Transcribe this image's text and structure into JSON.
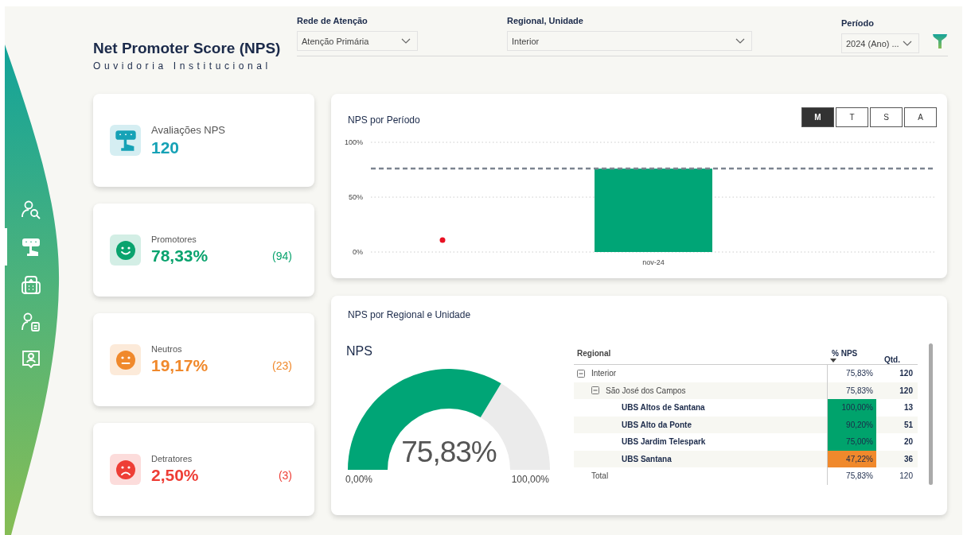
{
  "sidebar": {
    "items": [
      {
        "selected": false
      },
      {
        "selected": true
      },
      {
        "selected": false
      },
      {
        "selected": false
      },
      {
        "selected": false
      }
    ]
  },
  "header": {
    "title": "Net Promoter Score (NPS)",
    "subtitle": "Ouvidoria Institucional"
  },
  "filters": [
    {
      "label": "Rede de Atenção",
      "value": "Atenção Primária"
    },
    {
      "label": "Regional, Unidade",
      "value": "Interior"
    },
    {
      "label": "Período",
      "value": "2024 (Ano) ..."
    }
  ],
  "kpis": [
    {
      "kind": "rating",
      "label": "Avaliações NPS",
      "value": "120",
      "color": "#16a2b6"
    },
    {
      "kind": "happy",
      "label": "Promotores",
      "value": "78,33%",
      "count": "(94)",
      "color": "#0aa36e"
    },
    {
      "kind": "neutral",
      "label": "Neutros",
      "value": "19,17%",
      "count": "(23)",
      "color": "#f0892c"
    },
    {
      "kind": "sad",
      "label": "Detratores",
      "value": "2,50%",
      "count": "(3)",
      "color": "#ee3e36"
    }
  ],
  "period_chart": {
    "title": "NPS por Período",
    "periods": [
      {
        "label": "M",
        "selected": true
      },
      {
        "label": "T",
        "selected": false
      },
      {
        "label": "S",
        "selected": false
      },
      {
        "label": "A",
        "selected": false
      }
    ],
    "chart_data": {
      "type": "bar",
      "categories": [
        "nov-24"
      ],
      "values": [
        76
      ],
      "ylim": [
        0,
        100
      ],
      "yticks": [
        {
          "value": 0,
          "label": "0%"
        },
        {
          "value": 50,
          "label": "50%"
        },
        {
          "value": 100,
          "label": "100%"
        }
      ],
      "ref_lines": [
        {
          "axis": "y",
          "value": 76
        }
      ]
    }
  },
  "regional": {
    "title": "NPS por Regional e Unidade",
    "gauge": {
      "title": "NPS",
      "value": "75,83%",
      "level": 0.7583,
      "min": "0,00%",
      "max": "100,00%"
    },
    "table": {
      "columns": [
        {
          "label": "Regional",
          "sorted": false
        },
        {
          "label": "% NPS",
          "sorted": true
        },
        {
          "label": "Qtd.",
          "sorted": false
        }
      ],
      "rows": [
        {
          "name": "Interior",
          "nps": "75,83%",
          "qtd": "120",
          "expanded": true,
          "children": [
            {
              "name": "São José dos Campos",
              "nps": "75,83%",
              "qtd": "120",
              "expanded": true,
              "children": [
                {
                  "name": "UBS Altos de Santana",
                  "nps": "100,00%",
                  "qtd": "13",
                  "color": "#00a36c"
                },
                {
                  "name": "UBS Alto da Ponte",
                  "nps": "90,20%",
                  "qtd": "51",
                  "color": "#00a36c"
                },
                {
                  "name": "UBS Jardim Telespark",
                  "nps": "75,00%",
                  "qtd": "20",
                  "color": "#00a36c"
                },
                {
                  "name": "UBS Santana",
                  "nps": "47,22%",
                  "qtd": "36",
                  "color": "#f0892c"
                }
              ]
            }
          ]
        }
      ],
      "total": {
        "label": "Total",
        "nps": "75,83%",
        "qtd": "120"
      }
    }
  }
}
